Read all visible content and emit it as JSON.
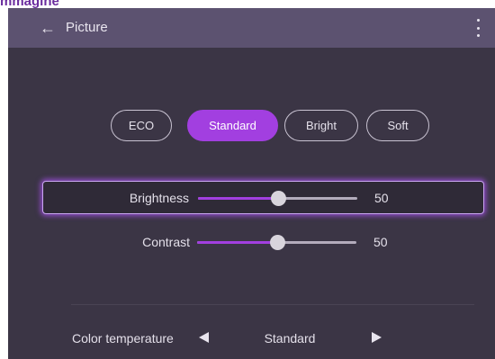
{
  "caption": "mmagine",
  "header": {
    "back_icon": "arrow-left-icon",
    "title": "Picture",
    "more_icon": "more-vertical-icon"
  },
  "picture_modes": {
    "selected": "Standard",
    "options": [
      "ECO",
      "Standard",
      "Bright",
      "Soft"
    ]
  },
  "colors": {
    "accent": "#a23fe0",
    "background": "#3b3545",
    "topbar": "#5c5270"
  },
  "brightness": {
    "label": "Brightness",
    "value": 50,
    "max": 100,
    "value_text": "50"
  },
  "contrast": {
    "label": "Contrast",
    "value": 50,
    "max": 100,
    "value_text": "50"
  },
  "color_temperature": {
    "label": "Color temperature",
    "value": "Standard",
    "prev_icon": "triangle-left-icon",
    "next_icon": "triangle-right-icon"
  }
}
